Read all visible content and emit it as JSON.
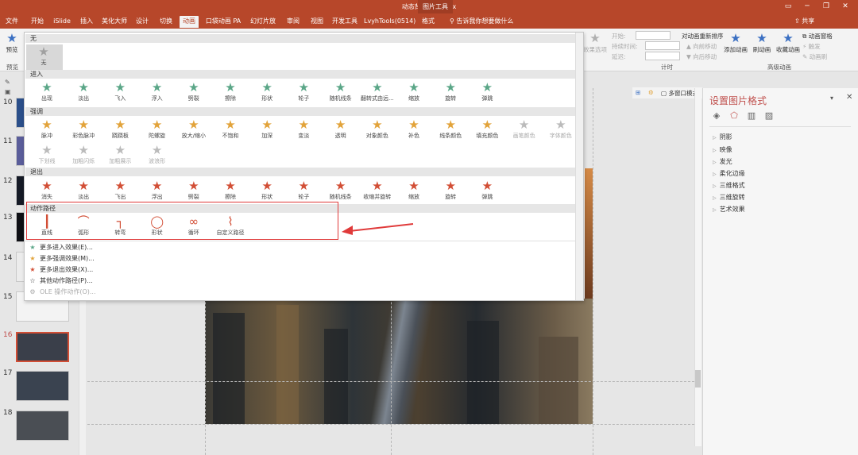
{
  "window": {
    "title": "动态背景展示.pptx",
    "context_tab": "图片工具"
  },
  "tabs": [
    "文件",
    "开始",
    "iSlide",
    "插入",
    "美化大师",
    "设计",
    "切换",
    "动画",
    "口袋动画 PA",
    "幻灯片放映",
    "审阅",
    "视图",
    "开发工具",
    "LvyhTools(0514)",
    "格式"
  ],
  "search_placeholder": "告诉我你想要做什么",
  "share_label": "共享",
  "ribbon": {
    "preview": "预览",
    "preview_group": "预览",
    "effect_options": "效果选项",
    "start_label": "开始:",
    "duration_label": "持续时间:",
    "delay_label": "延迟:",
    "reorder_label": "对动画重新排序",
    "move_earlier": "向前移动",
    "move_later": "向后移动",
    "timing_group": "计时",
    "add_animation": "添加动画",
    "animation_painter": "刷动画",
    "favorite_animation": "收藏动画",
    "animation_pane": "动画窗格",
    "trigger": "触发",
    "animation_brush": "动画刷",
    "advanced_group": "高级动画"
  },
  "gallery": {
    "none_header": "无",
    "none_item": "无",
    "entrance_header": "进入",
    "entrance": [
      "出现",
      "淡出",
      "飞入",
      "浮入",
      "劈裂",
      "擦除",
      "形状",
      "轮子",
      "随机线条",
      "翻转式由远...",
      "缩放",
      "旋转",
      "弹跳"
    ],
    "emphasis_header": "强调",
    "emphasis_row1": [
      "脉冲",
      "彩色脉冲",
      "跷跷板",
      "陀螺旋",
      "放大/缩小",
      "不饱和",
      "加深",
      "变淡",
      "透明",
      "对象颜色",
      "补色",
      "线条颜色",
      "填充颜色",
      "画笔颜色",
      "字体颜色"
    ],
    "emphasis_row2": [
      "下划线",
      "加粗闪烁",
      "加粗展示",
      "波浪形"
    ],
    "exit_header": "退出",
    "exit": [
      "消失",
      "淡出",
      "飞出",
      "浮出",
      "劈裂",
      "擦除",
      "形状",
      "轮子",
      "随机线条",
      "收缩并旋转",
      "缩放",
      "旋转",
      "弹跳"
    ],
    "motion_header": "动作路径",
    "motion": [
      "直线",
      "弧形",
      "转弯",
      "形状",
      "循环",
      "自定义路径"
    ],
    "more": [
      "更多进入效果(E)...",
      "更多强调效果(M)...",
      "更多退出效果(X)...",
      "其他动作路径(P)...",
      "OLE 操作动作(O)..."
    ]
  },
  "slides": [
    "10",
    "11",
    "12",
    "13",
    "14",
    "15",
    "16",
    "17",
    "18"
  ],
  "viewbar_label": "多窗口模式",
  "right_pane": {
    "title": "设置图片格式",
    "sections": [
      "阴影",
      "映像",
      "发光",
      "柔化边缘",
      "三维格式",
      "三维旋转",
      "艺术效果"
    ]
  },
  "colors": {
    "accent": "#b7472a",
    "highlight_box": "#e03a3a"
  }
}
